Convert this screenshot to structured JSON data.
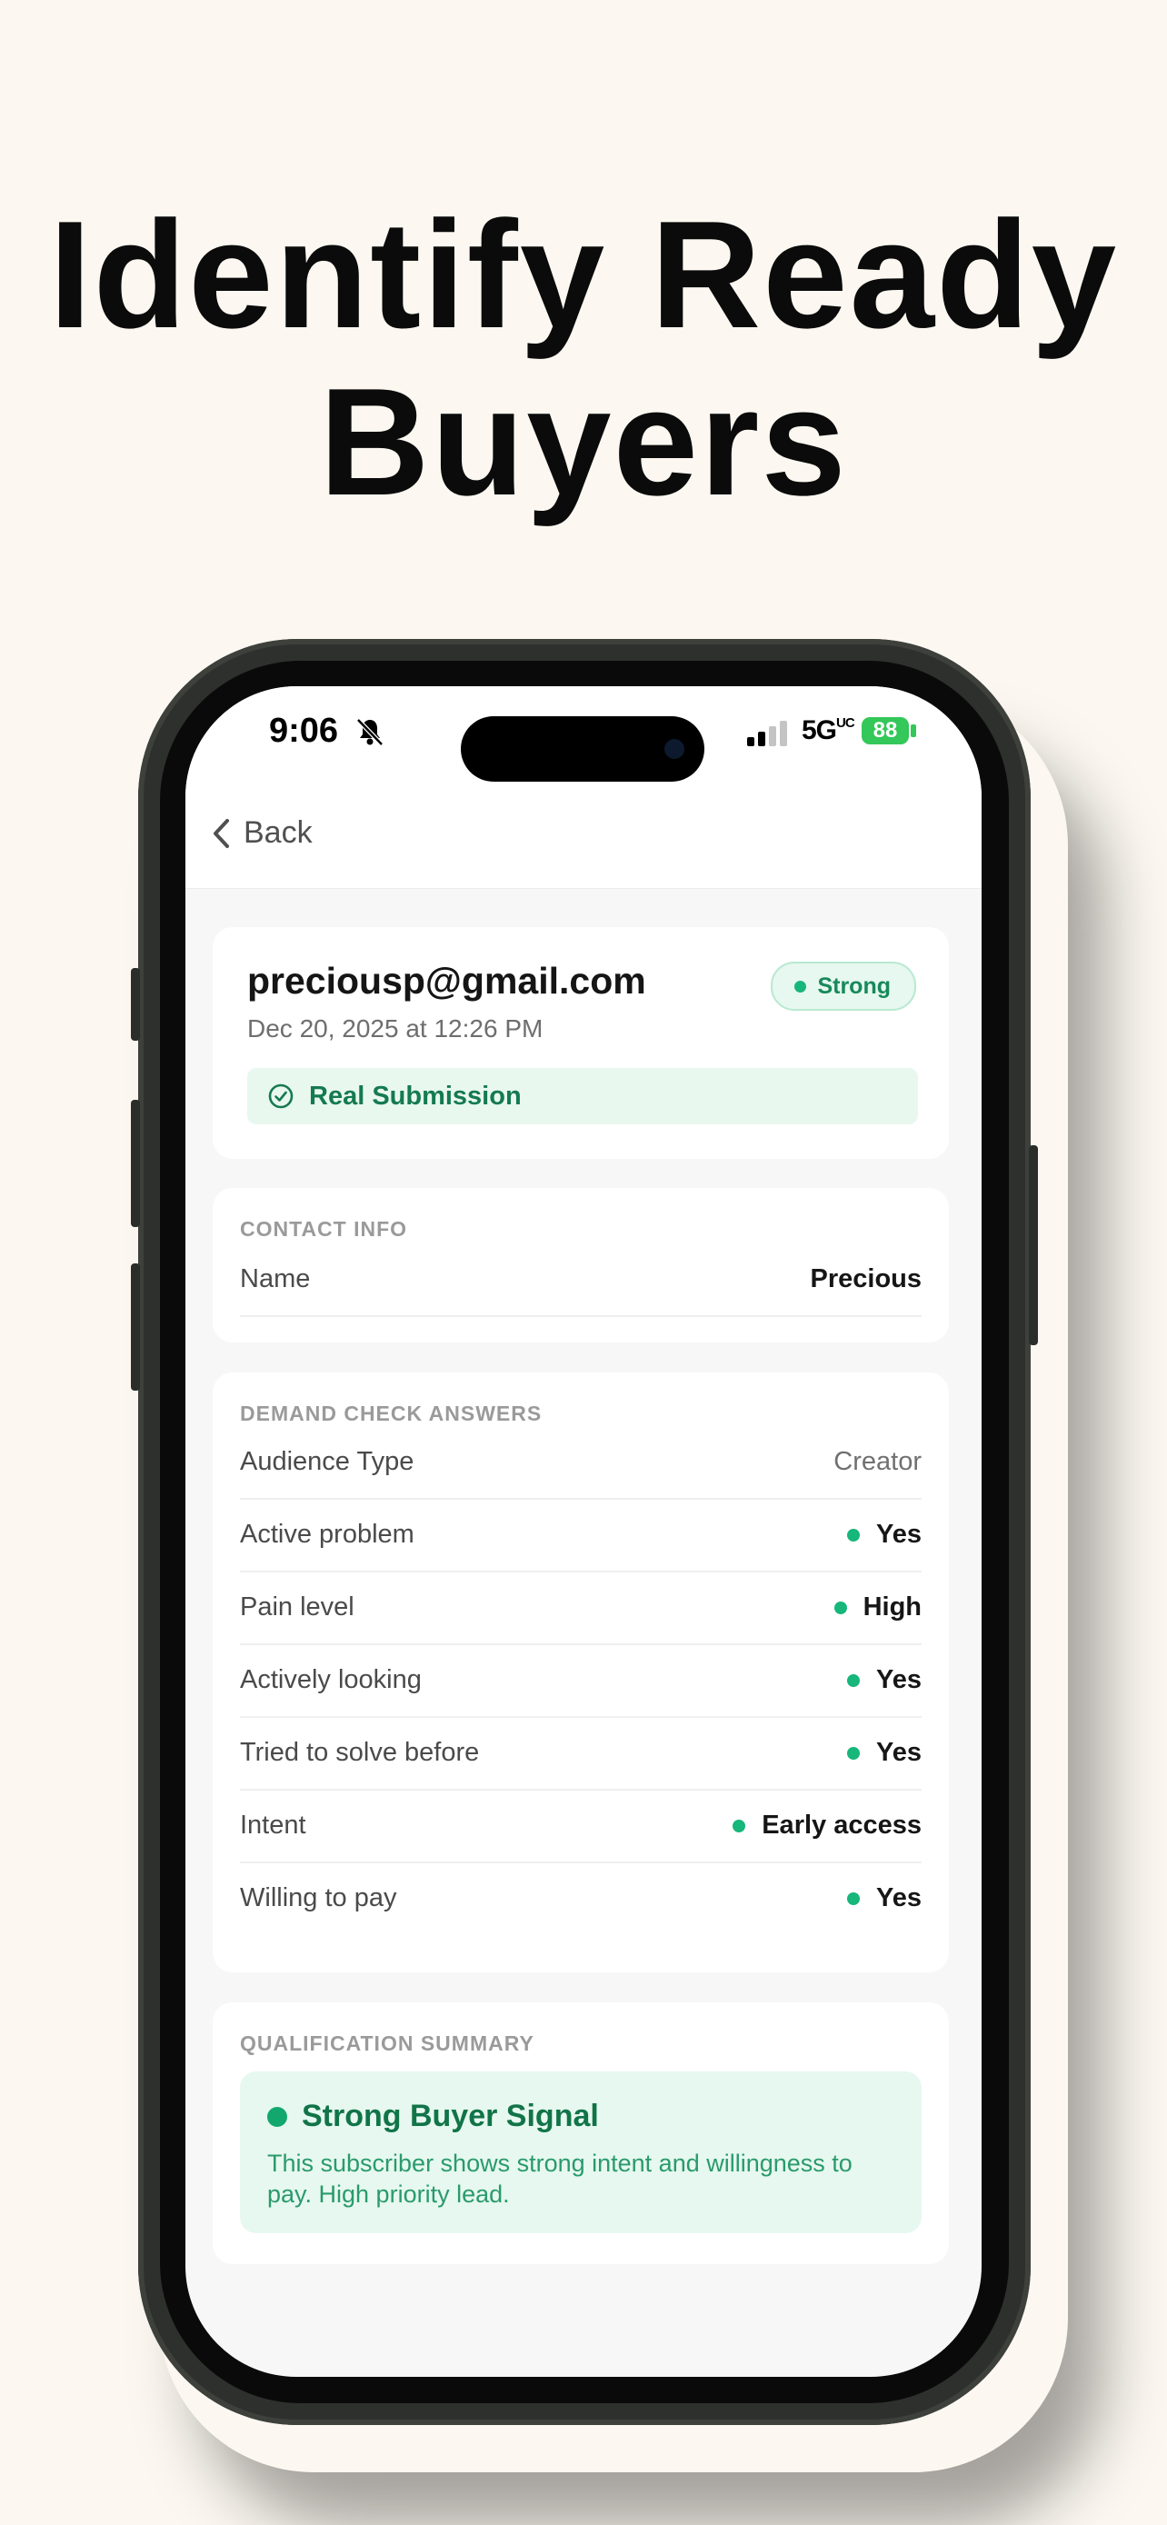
{
  "headline": {
    "line1": "Identify Ready",
    "line2": "Buyers"
  },
  "status_bar": {
    "time": "9:06",
    "network": "5G",
    "network_suffix": "UC",
    "battery": "88"
  },
  "nav": {
    "back_label": "Back"
  },
  "submission": {
    "email": "preciousp@gmail.com",
    "date": "Dec 20, 2025 at 12:26 PM",
    "badge": "Strong",
    "real_label": "Real Submission"
  },
  "contact_info": {
    "title": "CONTACT INFO",
    "rows": [
      {
        "label": "Name",
        "value": "Precious"
      }
    ]
  },
  "demand_check": {
    "title": "DEMAND CHECK ANSWERS",
    "rows": [
      {
        "label": "Audience Type",
        "value": "Creator"
      },
      {
        "label": "Active problem",
        "value": "Yes"
      },
      {
        "label": "Pain level",
        "value": "High"
      },
      {
        "label": "Actively looking",
        "value": "Yes"
      },
      {
        "label": "Tried to solve before",
        "value": "Yes"
      },
      {
        "label": "Intent",
        "value": "Early access"
      },
      {
        "label": "Willing to pay",
        "value": "Yes"
      }
    ]
  },
  "qualification": {
    "title": "QUALIFICATION SUMMARY",
    "signal": "Strong Buyer Signal",
    "description": "This subscriber shows strong intent and willingness to pay. High priority lead."
  },
  "colors": {
    "accent": "#17b67a",
    "accent_dark": "#117448",
    "background": "#fcf8f1"
  }
}
